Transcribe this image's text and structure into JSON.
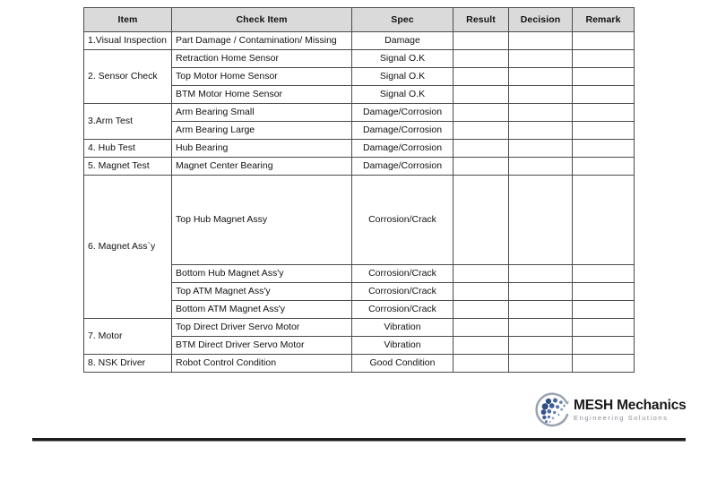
{
  "table": {
    "columns": [
      {
        "key": "item",
        "label": "Item"
      },
      {
        "key": "check",
        "label": "Check Item"
      },
      {
        "key": "spec",
        "label": "Spec"
      },
      {
        "key": "result",
        "label": "Result"
      },
      {
        "key": "decision",
        "label": "Decision"
      },
      {
        "key": "remark",
        "label": "Remark"
      }
    ],
    "header_background": "#dadada",
    "border_color": "#4b4b4b",
    "rows": [
      {
        "item": "1.Visual Inspection",
        "item_rowspan": 1,
        "check": "Part  Damage / Contamination/ Missing",
        "spec": "Damage",
        "result": "",
        "decision": "",
        "remark": "",
        "tall": false
      },
      {
        "item": "2. Sensor Check",
        "item_rowspan": 3,
        "check": "Retraction Home Sensor",
        "spec": "Signal O.K",
        "result": "",
        "decision": "",
        "remark": "",
        "tall": false
      },
      {
        "item": null,
        "check": "Top Motor Home Sensor",
        "spec": "Signal O.K",
        "result": "",
        "decision": "",
        "remark": "",
        "tall": false
      },
      {
        "item": null,
        "check": "BTM Motor Home Sensor",
        "spec": "Signal O.K",
        "result": "",
        "decision": "",
        "remark": "",
        "tall": false
      },
      {
        "item": "3.Arm Test",
        "item_rowspan": 2,
        "check": "Arm Bearing Small",
        "spec": "Damage/Corrosion",
        "result": "",
        "decision": "",
        "remark": "",
        "tall": false
      },
      {
        "item": null,
        "check": "Arm Bearing Large",
        "spec": "Damage/Corrosion",
        "result": "",
        "decision": "",
        "remark": "",
        "tall": false
      },
      {
        "item": "4. Hub Test",
        "item_rowspan": 1,
        "check": "Hub Bearing",
        "spec": "Damage/Corrosion",
        "result": "",
        "decision": "",
        "remark": "",
        "tall": false
      },
      {
        "item": "5. Magnet Test",
        "item_rowspan": 1,
        "check": "Magnet Center Bearing",
        "spec": "Damage/Corrosion",
        "result": "",
        "decision": "",
        "remark": "",
        "tall": false
      },
      {
        "item": "6. Magnet Ass`y",
        "item_rowspan": 4,
        "check": "Top  Hub Magnet Assy",
        "spec": "Corrosion/Crack",
        "result": "",
        "decision": "",
        "remark": "",
        "tall": true
      },
      {
        "item": null,
        "check": "Bottom Hub Magnet Ass'y",
        "spec": "Corrosion/Crack",
        "result": "",
        "decision": "",
        "remark": "",
        "tall": false
      },
      {
        "item": null,
        "check": "Top ATM Magnet Ass'y",
        "spec": "Corrosion/Crack",
        "result": "",
        "decision": "",
        "remark": "",
        "tall": false
      },
      {
        "item": null,
        "check": "Bottom ATM Magnet Ass'y",
        "spec": "Corrosion/Crack",
        "result": "",
        "decision": "",
        "remark": "",
        "tall": false
      },
      {
        "item": "7. Motor",
        "item_rowspan": 2,
        "check": "Top Direct Driver Servo Motor",
        "spec": "Vibration",
        "result": "",
        "decision": "",
        "remark": "",
        "tall": false
      },
      {
        "item": null,
        "check": "BTM Direct Driver Servo Motor",
        "spec": "Vibration",
        "result": "",
        "decision": "",
        "remark": "",
        "tall": false
      },
      {
        "item": "8. NSK Driver",
        "item_rowspan": 1,
        "check": "Robot Control Condition",
        "spec": "Good Condition",
        "result": "",
        "decision": "",
        "remark": "",
        "tall": false
      }
    ]
  },
  "logo": {
    "mark_name": "mesh-globe-icon",
    "title": "MESH Mechanics",
    "tagline": "Engineering Solutions",
    "dot_color": "#2e4f86",
    "dot_color_light": "#7b93bd",
    "arc_color": "#9aa4b0",
    "title_color": "#1a1a1a",
    "tagline_color": "#8a8f96"
  },
  "footer": {
    "rule_color": "#1c1c1c"
  }
}
